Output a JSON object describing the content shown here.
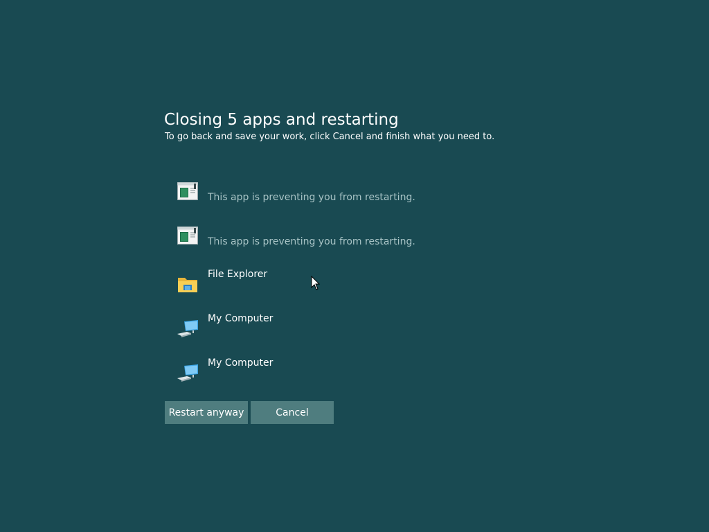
{
  "header": {
    "title": "Closing 5 apps and restarting",
    "subtitle": "To go back and save your work, click Cancel and finish what you need to."
  },
  "apps": [
    {
      "name": "",
      "status": "This app is preventing you from restarting.",
      "icon": "generic-app-window-icon"
    },
    {
      "name": "",
      "status": "This app is preventing you from restarting.",
      "icon": "generic-app-window-icon"
    },
    {
      "name": "File Explorer",
      "status": "",
      "icon": "folder-icon"
    },
    {
      "name": "My Computer",
      "status": "",
      "icon": "computer-icon"
    },
    {
      "name": "My Computer",
      "status": "",
      "icon": "computer-icon"
    }
  ],
  "buttons": {
    "restart_label": "Restart anyway",
    "cancel_label": "Cancel"
  },
  "colors": {
    "background": "#194a52",
    "button": "#4f7d7f",
    "status_text": "#a9c4c6"
  }
}
